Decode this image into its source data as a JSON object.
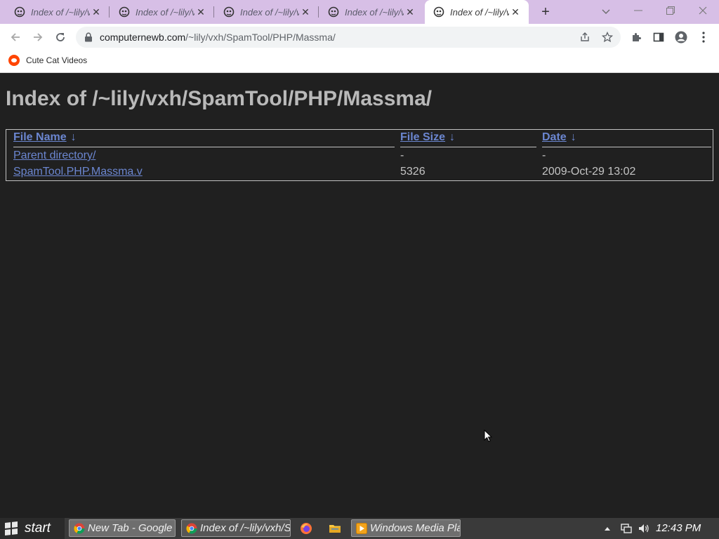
{
  "browser": {
    "tabs": [
      {
        "title": "Index of /~lily/vxh/SpamTool/PHP/Massma/",
        "active": false
      },
      {
        "title": "Index of /~lily/vxh/SpamTool/PHP/Massma/",
        "active": false
      },
      {
        "title": "Index of /~lily/vxh/SpamTool/PHP/Massma/",
        "active": false
      },
      {
        "title": "Index of /~lily/vxh/SpamTool/PHP/Massma/",
        "active": false
      },
      {
        "title": "Index of /~lily/vxh/SpamTool/PHP/Massma/",
        "active": true
      }
    ],
    "tab_close_glyph": "✕",
    "new_tab_glyph": "+",
    "address": {
      "host": "computernewb.com",
      "path": "/~lily/vxh/SpamTool/PHP/Massma/"
    },
    "bookmarks": [
      {
        "label": "Cute Cat Videos",
        "icon": "reddit-icon"
      }
    ],
    "colors": {
      "tabstrip": "#d7bfe6",
      "toolbar": "#ffffff",
      "page_bg": "#202020",
      "link": "#6b86d0"
    }
  },
  "page": {
    "heading": "Index of /~lily/vxh/SpamTool/PHP/Massma/",
    "columns": {
      "name": "File Name",
      "size": "File Size",
      "date": "Date",
      "sort_arrow": "↓"
    },
    "rows": [
      {
        "name": "Parent directory/",
        "size": "-",
        "date": "-"
      },
      {
        "name": "SpamTool.PHP.Massma.v",
        "size": "5326",
        "date": "2009-Oct-29 13:02"
      }
    ]
  },
  "taskbar": {
    "start_label": "start",
    "items": [
      {
        "label": "New Tab - Google Chrome",
        "icon": "chrome-icon"
      },
      {
        "label": "Index of /~lily/vxh/SpamTool/PHP/Massma/",
        "icon": "chrome-icon"
      },
      {
        "label": "Windows Media Player",
        "icon": "media-player-icon"
      }
    ],
    "quick_launch": [
      "firefox-icon",
      "folder-icon"
    ],
    "tray_icons": [
      "show-hidden-icons-arrow",
      "network-icon",
      "volume-icon"
    ],
    "clock": "12:43 PM"
  }
}
